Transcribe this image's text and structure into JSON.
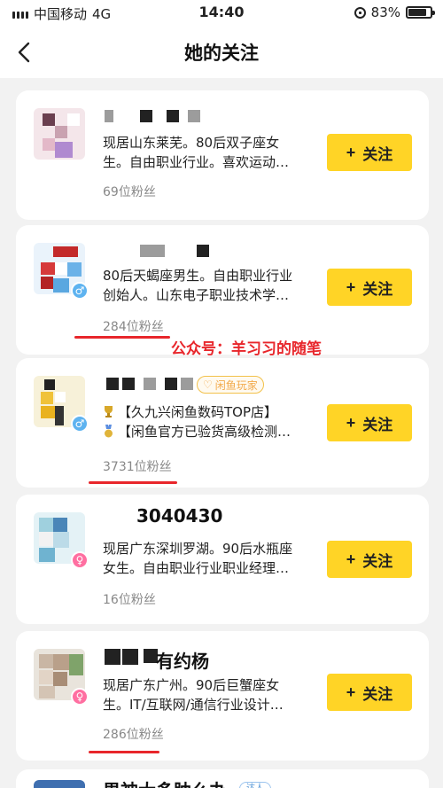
{
  "status_bar": {
    "carrier": "中国移动",
    "network": "4G",
    "time": "14:40",
    "battery": "83%",
    "battery_level": 0.83
  },
  "nav": {
    "title": "她的关注"
  },
  "follow_label": "关注",
  "watermark": "公众号：羊习习的随笔",
  "users": [
    {
      "name": "",
      "lines": [
        "现居山东莱芜。80后双子座女",
        "生。自由职业行业。喜欢运动…"
      ],
      "fans": "69位粉丝",
      "gender": ""
    },
    {
      "name": "",
      "lines": [
        "80后天蝎座男生。自由职业行业",
        "创始人。山东电子职业技术学…"
      ],
      "fans": "284位粉丝",
      "gender": "♂"
    },
    {
      "name": "",
      "tag": "闲鱼玩家",
      "lines": [
        "【久九兴闲鱼数码TOP店】",
        "【闲鱼官方已验货高级检测…"
      ],
      "fans": "3731位粉丝",
      "gender": "♂"
    },
    {
      "name": "3040430",
      "lines": [
        "现居广东深圳罗湖。90后水瓶座",
        "女生。自由职业行业职业经理…"
      ],
      "fans": "16位粉丝",
      "gender": "♀"
    },
    {
      "name": "有约杨",
      "lines": [
        "现居广东广州。90后巨蟹座女",
        "生。IT/互联网/通信行业设计…"
      ],
      "fans": "286位粉丝",
      "gender": "♀"
    }
  ],
  "partial_user": {
    "name": "男神大多肿么办",
    "tag": "达人"
  },
  "colors": {
    "accent_yellow": "#ffd426",
    "highlight_red": "#e8262b",
    "background": "#f2f2f2"
  }
}
